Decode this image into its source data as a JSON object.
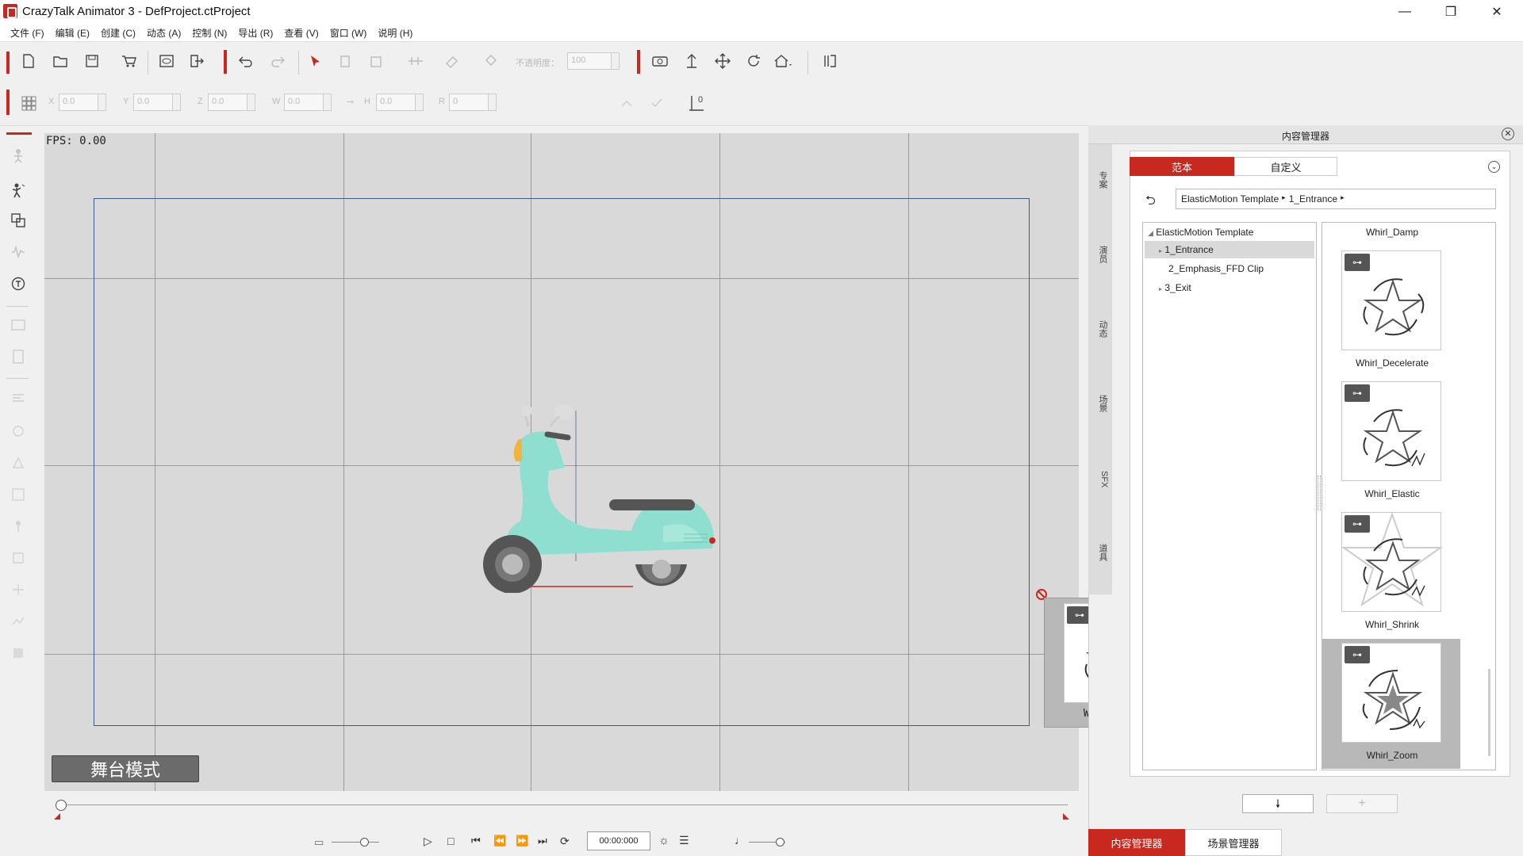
{
  "window": {
    "title": "CrazyTalk Animator 3 - DefProject.ctProject",
    "controls": [
      "—",
      "❐",
      "✕"
    ]
  },
  "menu": [
    "文件 (F)",
    "编辑 (E)",
    "创建 (C)",
    "动态 (A)",
    "控制 (N)",
    "导出 (R)",
    "查看 (V)",
    "窗口 (W)",
    "说明 (H)"
  ],
  "toolbar1": {
    "opacity_label": "不透明度：",
    "opacity_value": "100"
  },
  "toolbar2": {
    "fields": [
      {
        "label": "X",
        "value": "0.0"
      },
      {
        "label": "Y",
        "value": "0.0"
      },
      {
        "label": "Z",
        "value": "0.0"
      },
      {
        "label": "W",
        "value": "0.0"
      },
      {
        "label": "H",
        "value": "0.0"
      },
      {
        "label": "R",
        "value": "0"
      }
    ],
    "layer_value": "0"
  },
  "stage": {
    "fps": "FPS: 0.00",
    "mode_button": "舞台模式"
  },
  "timeline": {
    "time": "00:00:000"
  },
  "content_manager": {
    "title": "内容管理器",
    "vertical_tabs": [
      "专案",
      "演员",
      "动态",
      "场景",
      "SFX",
      "道具"
    ],
    "tabs": [
      "范本",
      "自定义"
    ],
    "breadcrumb": [
      "ElasticMotion Template",
      "1_Entrance"
    ],
    "tree": {
      "root": "ElasticMotion Template",
      "children": [
        "1_Entrance",
        "2_Emphasis_FFD Clip",
        "3_Exit"
      ]
    },
    "thumbnails_header": "Whirl_Damp",
    "thumbnails": [
      "Whirl_Decelerate",
      "Whirl_Elastic",
      "Whirl_Shrink",
      "Whirl_Zoom"
    ],
    "drag_preview": "Whirl_Zoom"
  },
  "bottom_tabs": [
    "内容管理器",
    "场景管理器"
  ],
  "colors": {
    "accent": "#c8281e",
    "scooter": "#8edfcf",
    "stage": "#d9d9d9"
  }
}
